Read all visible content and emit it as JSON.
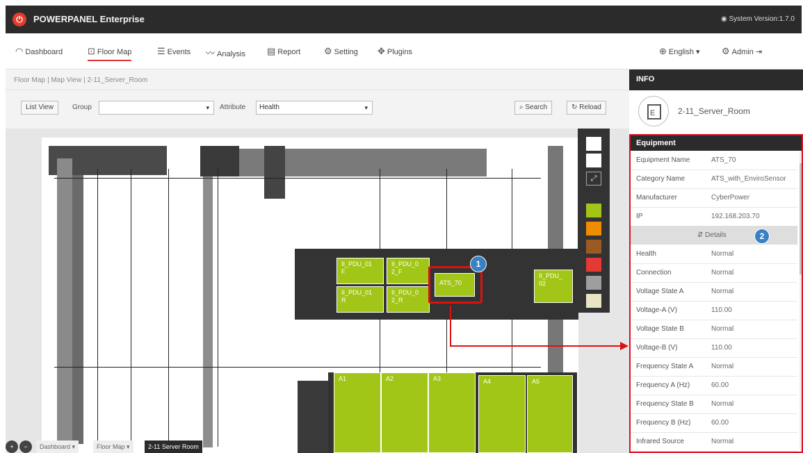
{
  "app": {
    "title": "POWERPANEL Enterprise",
    "system_version": "System Version:1.7.0"
  },
  "nav": {
    "dashboard": "Dashboard",
    "floor_map": "Floor Map",
    "events": "Events",
    "analysis": "Analysis",
    "report": "Report",
    "setting": "Setting",
    "plugins": "Plugins",
    "language": "English",
    "user": "Admin"
  },
  "breadcrumb": [
    "Floor Map",
    "Map View",
    "2-11_Server_Room"
  ],
  "toolbar": {
    "list_view": "List View",
    "group_label": "Group",
    "group_value": "",
    "attribute_label": "Attribute",
    "attribute_value": "Health",
    "search": "Search",
    "reload": "Reload"
  },
  "devices": {
    "pdu1": "II_PDU_01\nF",
    "pdu2": "II_PDU_01\nR",
    "pdu3": "II_PDU_0\n2_F",
    "pdu4": "II_PDU_0\n2_R",
    "ats": "ATS_70",
    "pdu5": "II_PDU_\n02",
    "a1": "A1",
    "a2": "A2",
    "a3": "A3",
    "a4": "A4",
    "a5": "A5"
  },
  "badges": {
    "one": "1",
    "two": "2"
  },
  "palette": {
    "colors": [
      "#ffffff",
      "#ffffff",
      "#a2c617",
      "#f08c00",
      "#9c5a23",
      "#e53935",
      "#9e9e9e",
      "#e8e4c4"
    ],
    "expand_icon": "expand-icon"
  },
  "info": {
    "header": "INFO",
    "device_name": "2-11_Server_Room",
    "equipment_header": "Equipment",
    "rows_top": [
      {
        "k": "Equipment Name",
        "v": "ATS_70"
      },
      {
        "k": "Category Name",
        "v": "ATS_with_EnviroSensor"
      },
      {
        "k": "Manufacturer",
        "v": "CyberPower"
      },
      {
        "k": "IP",
        "v": "192.168.203.70"
      }
    ],
    "details": "Details",
    "rows_bottom": [
      {
        "k": "Health",
        "v": "Normal"
      },
      {
        "k": "Connection",
        "v": "Normal"
      },
      {
        "k": "Voltage State A",
        "v": "Normal"
      },
      {
        "k": "Voltage-A (V)",
        "v": "110.00"
      },
      {
        "k": "Voltage State B",
        "v": "Normal"
      },
      {
        "k": "Voltage-B (V)",
        "v": "110.00"
      },
      {
        "k": "Frequency State A",
        "v": "Normal"
      },
      {
        "k": "Frequency A (Hz)",
        "v": "60.00"
      },
      {
        "k": "Frequency State B",
        "v": "Normal"
      },
      {
        "k": "Frequency B (Hz)",
        "v": "60.00"
      },
      {
        "k": "Infrared Source",
        "v": "Normal"
      }
    ]
  },
  "bottom_tabs": {
    "dashboard": "Dashboard",
    "floor_map": "Floor Map",
    "current": "2-11 Server Room"
  }
}
